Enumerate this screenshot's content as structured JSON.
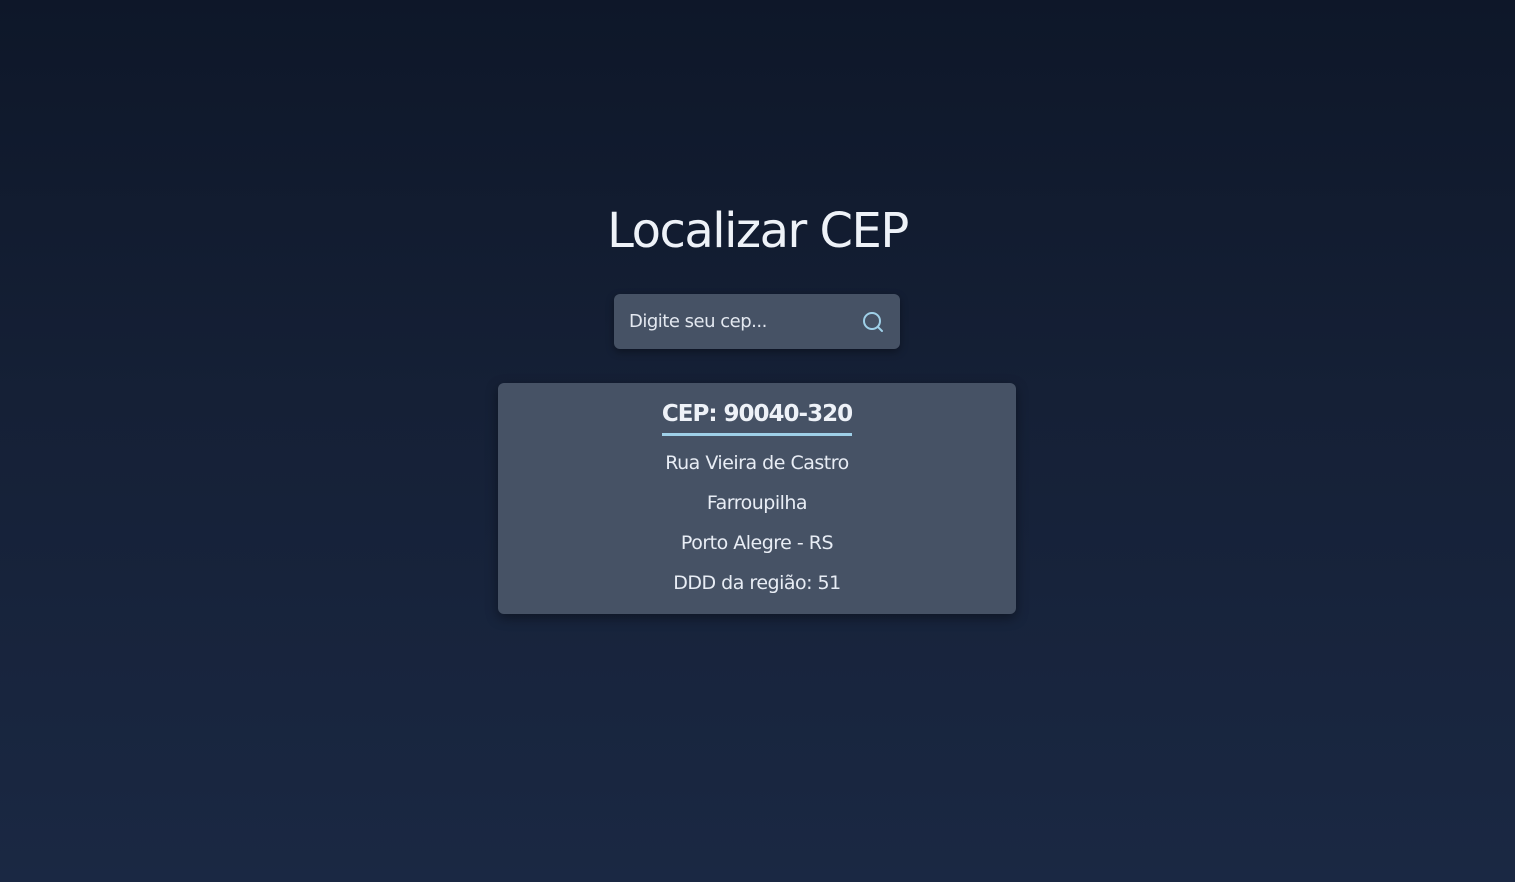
{
  "page": {
    "title": "Localizar CEP"
  },
  "search": {
    "placeholder": "Digite seu cep...",
    "value": "",
    "icon": "search-icon",
    "icon_color": "#9fd0e8"
  },
  "result": {
    "cep_label": "CEP: 90040-320",
    "street": "Rua Vieira de Castro",
    "neighborhood": "Farroupilha",
    "city_state": "Porto Alegre - RS",
    "ddd": "DDD da região: 51"
  },
  "colors": {
    "background_top": "#0e1729",
    "background_bottom": "#1a2843",
    "card": "#465265",
    "accent": "#9fd0e8",
    "text": "#eef2f8"
  }
}
